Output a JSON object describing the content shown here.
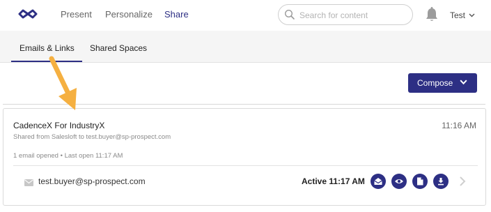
{
  "nav": {
    "logo_icon": "infinity-logo-icon",
    "items": [
      {
        "label": "Present",
        "active": false
      },
      {
        "label": "Personalize",
        "active": false
      },
      {
        "label": "Share",
        "active": true
      }
    ],
    "search_placeholder": "Search for content",
    "bell_icon": "bell-icon",
    "user_name": "Test"
  },
  "tabs": [
    {
      "label": "Emails & Links",
      "active": true
    },
    {
      "label": "Shared Spaces",
      "active": false
    }
  ],
  "compose_button": {
    "label": "Compose"
  },
  "card": {
    "title": "CadenceX For IndustryX",
    "time": "11:16 AM",
    "subtitle": "Shared from Salesloft to test.buyer@sp-prospect.com",
    "meta": "1 email opened • Last open 11:17 AM",
    "recipient": {
      "email": "test.buyer@sp-prospect.com",
      "status": "Active 11:17 AM",
      "actions": [
        "mail-open-icon",
        "eye-icon",
        "document-icon",
        "download-icon"
      ]
    }
  },
  "colors": {
    "accent": "#2d2f84",
    "annotation_arrow": "#f5b041"
  }
}
